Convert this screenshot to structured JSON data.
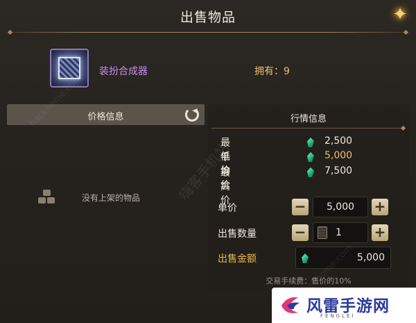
{
  "window": {
    "title": "出售物品",
    "close_icon": "close-sparkle-icon"
  },
  "item": {
    "icon": "outfit-synthesizer-cube-icon",
    "name": "装扮合成器",
    "owned_text": "拥有：9"
  },
  "price_panel": {
    "header": "价格信息",
    "refresh_icon": "refresh-icon",
    "empty_icon": "stacked-boxes-icon",
    "empty_text": "没有上架的物品"
  },
  "market_panel": {
    "header": "行情信息",
    "currency_icon": "green-gem-icon",
    "stats": [
      {
        "label": "最低价",
        "value": "2,500"
      },
      {
        "label": "平均价",
        "value": "5,000"
      },
      {
        "label": "最高价",
        "value": "7,500"
      }
    ]
  },
  "sell_form": {
    "unit_price_label": "单价",
    "unit_price_value": "5,000",
    "quantity_label": "出售数量",
    "quantity_value": "1",
    "total_label": "出售金额",
    "total_value": "5,000",
    "minus_symbol": "−",
    "plus_symbol": "+",
    "fee_note": "交易手续费：售价的10%"
  },
  "watermarks": {
    "url": "hackhome.com",
    "cn": "嗨客手机站"
  },
  "brand": {
    "name": "风雷手游网",
    "sub": "FENGLEI"
  },
  "colors": {
    "item_name": "#c58cf2",
    "accent_gold": "#e8c070",
    "total_label": "#e8b84a",
    "gem": "#1fb47e"
  }
}
